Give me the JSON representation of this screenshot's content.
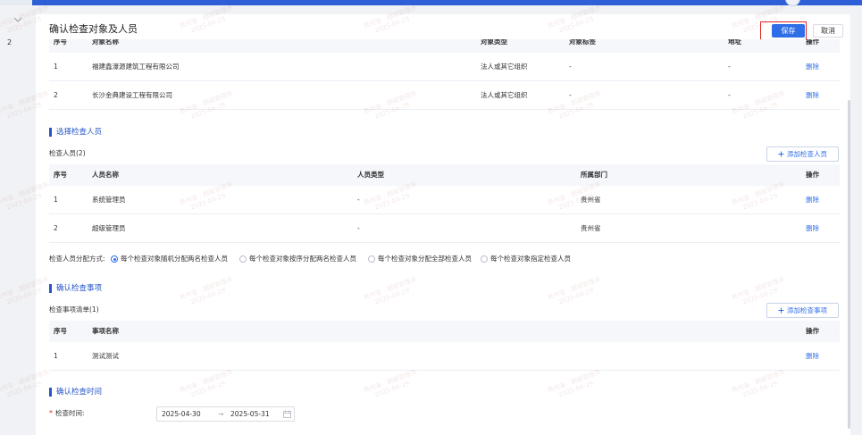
{
  "colors": {
    "primary": "#2e6ee6",
    "highlight": "#e02424",
    "section": "#2756c9",
    "topbar": "#2f5fd6"
  },
  "icons": {
    "side": "chevron-down-icon",
    "add": "plus-icon",
    "date": "calendar-icon"
  },
  "side": {
    "row_number": "2"
  },
  "dialog": {
    "title": "确认检查对象及人员",
    "save_label": "保存",
    "cancel_label": "取消"
  },
  "objects": {
    "columns": [
      "序号",
      "对象名称",
      "对象类型",
      "对象标签",
      "地址",
      "操作"
    ],
    "rows": [
      {
        "index": "1",
        "name": "福建鑫濠源建筑工程有限公司",
        "type": "法人或其它组织",
        "tag": "-",
        "address": "-",
        "action": "删除"
      },
      {
        "index": "2",
        "name": "长沙金典建设工程有限公司",
        "type": "法人或其它组织",
        "tag": "-",
        "address": "-",
        "action": "删除"
      }
    ]
  },
  "personnel": {
    "section_title": "选择检查人员",
    "count_label": "检查人员(2)",
    "add_label": "添加检查人员",
    "columns": [
      "序号",
      "人员名称",
      "人员类型",
      "所属部门",
      "操作"
    ],
    "rows": [
      {
        "index": "1",
        "name": "系统管理员",
        "type": "-",
        "dept": "贵州省",
        "action": "删除"
      },
      {
        "index": "2",
        "name": "超级管理员",
        "type": "-",
        "dept": "贵州省",
        "action": "删除"
      }
    ],
    "assign_label": "检查人员分配方式:",
    "assign_options": [
      "每个检查对象随机分配两名检查人员",
      "每个检查对象按序分配两名检查人员",
      "每个检查对象分配全部检查人员",
      "每个检查对象指定检查人员"
    ],
    "assign_selected": 0
  },
  "items": {
    "section_title": "确认检查事项",
    "count_label": "检查事项清单(1)",
    "add_label": "添加检查事项",
    "columns": [
      "序号",
      "事项名称",
      "操作"
    ],
    "rows": [
      {
        "index": "1",
        "name": "测试测试",
        "action": "删除"
      }
    ]
  },
  "time": {
    "section_title": "确认检查时间",
    "required_mark": "*",
    "label": "检查时间:",
    "start": "2025-04-30",
    "separator": "→",
    "end": "2025-05-31"
  },
  "watermark": {
    "line1": "贵州省 · 超级管理员",
    "line2": "2025-04-29"
  }
}
